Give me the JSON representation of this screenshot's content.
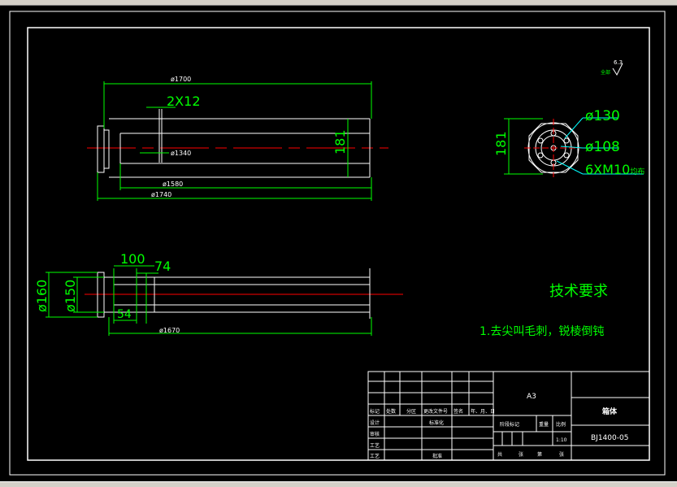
{
  "window": {
    "top_strip": "",
    "status": ""
  },
  "dims": {
    "top_d1700": "ø1700",
    "top_2x12": "2X12",
    "top_d1340": "ø1340",
    "top_181": "181",
    "top_d1580": "ø1580",
    "top_d1740": "ø1740",
    "side_181": "181",
    "side_d130": "ø130",
    "side_d108": "ø108",
    "side_6xm10": "6XM10",
    "side_6xm10_suffix": "均布",
    "bot_100": "100",
    "bot_74": "74",
    "bot_d160": "ø160",
    "bot_d150": "ø150",
    "bot_54": "54",
    "bot_d1670": "ø1670",
    "roughness_prefix": "全部",
    "roughness_value": "6.3"
  },
  "notes": {
    "title": "技术要求",
    "item1": "1.去尖叫毛刺，锐棱倒钝"
  },
  "title_block": {
    "sheet_size": "A3",
    "part_name": "箱体",
    "drawing_number": "BJ1400-05",
    "scale": "1:10",
    "cells": {
      "mark": "标记",
      "count": "处数",
      "zone": "分区",
      "change_doc": "更改文件号",
      "sign": "签名",
      "date": "年、月、日",
      "design": "设计",
      "standardize": "标准化",
      "check": "审核",
      "process": "工艺",
      "approve": "批准",
      "stage_mark": "阶段标记",
      "weight": "重量",
      "ratio": "比例",
      "total": "共",
      "sheets": "张",
      "page": "第",
      "sheet_unit": "张"
    }
  },
  "colors": {
    "frame": "#ffffff",
    "dim": "#00ff00",
    "centerline": "#ff0000",
    "geometry": "#ffffff",
    "annotation": "#ffffff",
    "leader": "#00ffff"
  }
}
